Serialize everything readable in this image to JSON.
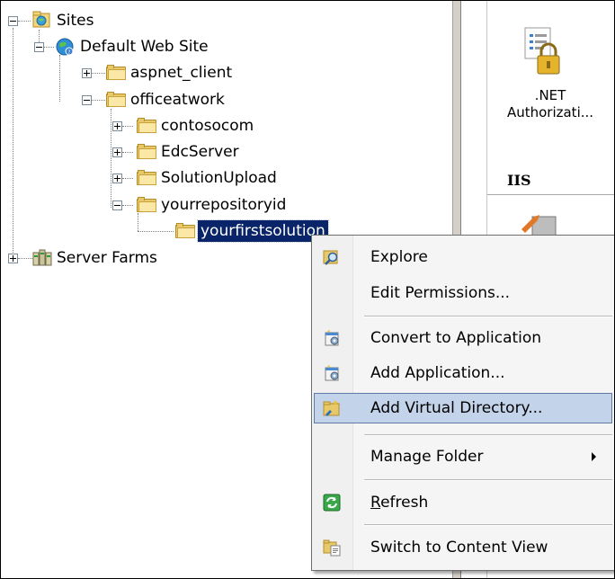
{
  "tree": {
    "sites": "Sites",
    "default_web_site": "Default Web Site",
    "aspnet_client": "aspnet_client",
    "officeatwork": "officeatwork",
    "contosocom": "contosocom",
    "edcserver": "EdcServer",
    "solutionupload": "SolutionUpload",
    "yourrepositoryid": "yourrepositoryid",
    "yourfirstsolution": "yourfirstsolution",
    "server_farms": "Server Farms"
  },
  "features": {
    "net_authorization": ".NET\nAuthorizati...",
    "iis_heading": "IIS"
  },
  "context_menu": {
    "items": [
      {
        "label": "Explore",
        "icon": "explore-icon"
      },
      {
        "label": "Edit Permissions..."
      },
      {
        "label": "Convert to Application",
        "icon": "application-icon"
      },
      {
        "label": "Add Application...",
        "icon": "application-icon"
      },
      {
        "label": "Add Virtual Directory...",
        "icon": "virtual-directory-icon"
      },
      {
        "label": "Manage Folder"
      },
      {
        "label": "Refresh",
        "icon": "refresh-icon"
      },
      {
        "label": "Switch to Content View",
        "icon": "content-view-icon"
      }
    ],
    "highlighted": "Add Virtual Directory..."
  },
  "colors": {
    "selection": "#0a246a",
    "menu_highlight": "#c3d3ea"
  }
}
